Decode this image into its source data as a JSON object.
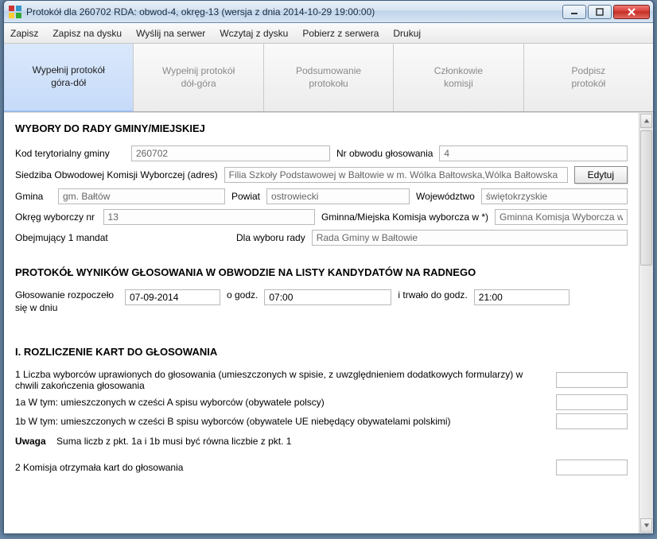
{
  "window": {
    "title": "Protokół dla 260702 RDA: obwod-4, okręg-13 (wersja z dnia 2014-10-29 19:00:00)"
  },
  "menu": {
    "save": "Zapisz",
    "save_disk": "Zapisz na dysku",
    "send_server": "Wyślij na serwer",
    "load_disk": "Wczytaj z dysku",
    "fetch_server": "Pobierz z serwera",
    "print": "Drukuj"
  },
  "tabs": {
    "t1a": "Wypełnij protokół",
    "t1b": "góra-dół",
    "t2a": "Wypełnij protokół",
    "t2b": "dół-góra",
    "t3a": "Podsumowanie",
    "t3b": "protokołu",
    "t4a": "Członkowie",
    "t4b": "komisji",
    "t5a": "Podpisz",
    "t5b": "protokół"
  },
  "section1": "WYBORY DO RADY GMINY/MIEJSKIEJ",
  "labels": {
    "kod": "Kod terytorialny gminy",
    "nr_obwodu": "Nr obwodu głosowania",
    "siedziba": "Siedziba Obwodowej Komisji Wyborczej (adres)",
    "gmina": "Gmina",
    "powiat": "Powiat",
    "woj": "Województwo",
    "okreg": "Okręg wyborczy nr",
    "komisja": "Gminna/Miejska Komisja wyborcza w *)",
    "mandat": "Obejmujący 1 mandat",
    "dla_wyboru": "Dla wyboru rady",
    "glos_start_a": "Głosowanie rozpoczeło",
    "glos_start_b": "się w dniu",
    "o_godz": "o godz.",
    "trwalo": "i trwało do godz."
  },
  "values": {
    "kod": "260702",
    "nr_obwodu": "4",
    "siedziba": "Filia Szkoły Podstawowej w Bałtowie w m. Wólka Bałtowska,Wólka Bałtowska",
    "gmina": "gm. Bałtów",
    "powiat": "ostrowiecki",
    "woj": "świętokrzyskie",
    "okreg": "13",
    "komisja": "Gminna Komisja Wyborcza w",
    "rada": "Rada Gminy w Bałtowie",
    "data": "07-09-2014",
    "godz_start": "07:00",
    "godz_end": "21:00"
  },
  "buttons": {
    "edytuj": "Edytuj"
  },
  "section2": "PROTOKÓŁ WYNIKÓW GŁOSOWANIA W OBWODZIE NA LISTY KANDYDATÓW NA RADNEGO",
  "section3": "I. ROZLICZENIE KART DO GŁOSOWANIA",
  "lines": {
    "l1": "1 Liczba wyborców uprawionych do głosowania (umieszczonych w spisie, z uwzględnieniem dodatkowych formularzy) w chwili zakończenia głosowania",
    "l1a": "1a W tym: umieszczonych w cześci A spisu wyborców (obywatele polscy)",
    "l1b": "1b W tym: umieszczonych w cześci B spisu wyborców (obywatele UE niebędący obywatelami polskimi)",
    "l2": "2 Komisja otrzymała kart do głosowania"
  },
  "uwaga_label": "Uwaga",
  "uwaga_text": "Suma liczb z pkt. 1a i 1b musi być  równa liczbie z pkt. 1"
}
